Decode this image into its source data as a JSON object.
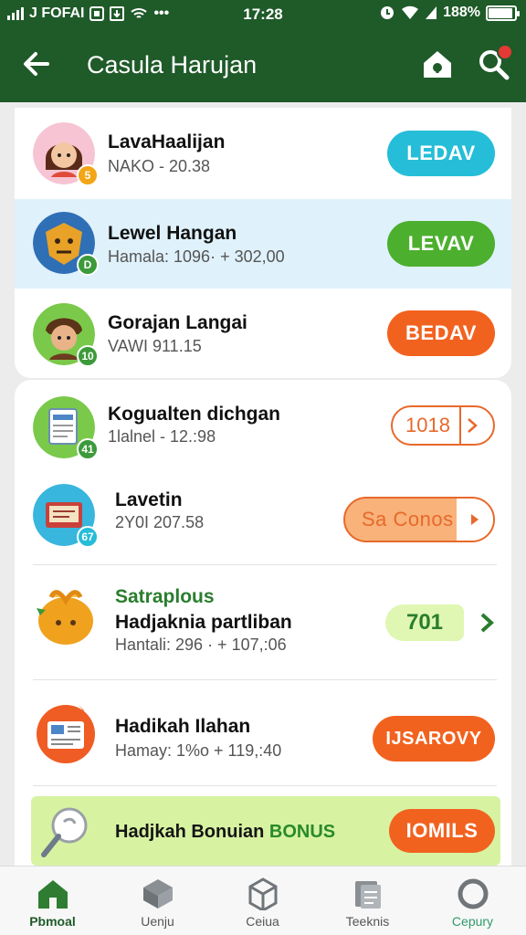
{
  "status_bar": {
    "carrier": "J FOFAI",
    "time": "17:28",
    "battery": "188%"
  },
  "app_bar": {
    "title": "Casula Harujan"
  },
  "items": [
    {
      "name": "LavaHaalijan",
      "sub": "NAKO - 20.38",
      "action": "LEDAV",
      "action_color": "#26bdd8",
      "badge": "5",
      "badge_color": "#f2a516"
    },
    {
      "name": "Lewel Hangan",
      "sub": "Hamala: 1096· + 302,00",
      "action": "LEVAV",
      "action_color": "#4caf2e",
      "badge": "D",
      "badge_color": "#3c9a3a"
    },
    {
      "name": "Gorajan Langai",
      "sub": "VAWI 911.15",
      "action": "BEDAV",
      "action_color": "#f2621f",
      "badge": "10",
      "badge_color": "#3c9a3a"
    },
    {
      "name": "Kogualten dichgan",
      "sub": "1lalnel - 12.:98",
      "action": "1018",
      "badge": "41",
      "badge_color": "#3c9a3a"
    },
    {
      "name": "Lavetin",
      "sub": "2Y0I 207.58",
      "action": "Sa Conos",
      "badge": "67",
      "badge_color": "#26bdd8"
    },
    {
      "tag": "Satraplous",
      "name": "Hadjaknia partliban",
      "sub": "Hantali: 296 · + 107,:06",
      "action": "701"
    },
    {
      "name": "Hadikah Ilahan",
      "sub": "Hamay: 1%o + 119,:40",
      "action": "IJSAROVY",
      "action_color": "#f2621f"
    },
    {
      "name": "Hadjkah Bonuian",
      "bonus": "BONUS",
      "action": "IOMILS",
      "action_color": "#f2621f"
    }
  ],
  "bottom_nav": [
    {
      "label": "Pbmoal",
      "icon": "home-icon",
      "active": true
    },
    {
      "label": "Uenju",
      "icon": "box-icon"
    },
    {
      "label": "Ceiua",
      "icon": "package-icon"
    },
    {
      "label": "Teeknis",
      "icon": "documents-icon"
    },
    {
      "label": "Cepury",
      "icon": "circle-icon"
    }
  ],
  "colors": {
    "primary": "#1f5a29",
    "highlight_row": "#dff1fb",
    "accent_orange": "#f2621f",
    "accent_cyan": "#26bdd8",
    "accent_green": "#4caf2e"
  }
}
